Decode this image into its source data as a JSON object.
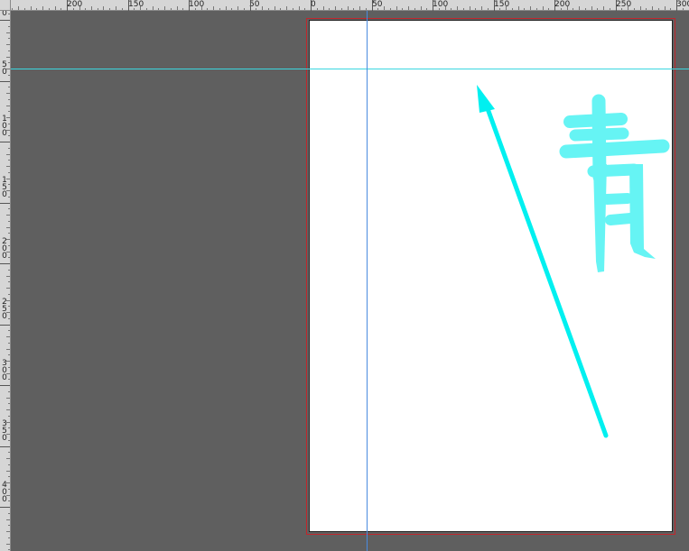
{
  "rulers": {
    "top_labels": [
      "200",
      "150",
      "100",
      "50",
      "0",
      "50",
      "100",
      "150",
      "200",
      "250",
      "300"
    ],
    "left_labels": [
      "0",
      "50",
      "100",
      "150",
      "200",
      "250",
      "300",
      "350",
      "400"
    ]
  },
  "canvas": {
    "background_color": "#5f5f5f",
    "paper_color": "#ffffff",
    "bleed_border_color": "#c0262c",
    "guide_horizontal_color": "#3ad7e0",
    "guide_vertical_color": "#4a8be0"
  },
  "drawing": {
    "stroke_color": "#00f0f0",
    "kanji_text": "青",
    "kanji_color": "#3ff0f0",
    "arrow_icon": "arrow-up-left-icon"
  }
}
